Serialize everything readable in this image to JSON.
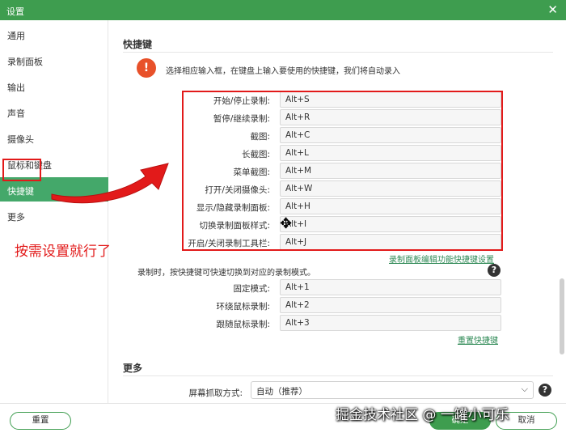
{
  "window": {
    "title": "设置",
    "close_glyph": "✕"
  },
  "sidebar": {
    "items": [
      {
        "label": "通用"
      },
      {
        "label": "录制面板"
      },
      {
        "label": "输出"
      },
      {
        "label": "声音"
      },
      {
        "label": "摄像头"
      },
      {
        "label": "鼠标和键盘"
      },
      {
        "label": "快捷键",
        "active": true
      },
      {
        "label": "更多"
      }
    ]
  },
  "annotation": {
    "text": "按需设置就行了",
    "color": "#e21a1a"
  },
  "shortcuts": {
    "title": "快捷键",
    "info_icon": "!",
    "info_text": "选择相应输入框，在键盘上输入要使用的快捷键，我们将自动录入",
    "rows": [
      {
        "label": "开始/停止录制:",
        "value": "Alt+S"
      },
      {
        "label": "暂停/继续录制:",
        "value": "Alt+R"
      },
      {
        "label": "截图:",
        "value": "Alt+C"
      },
      {
        "label": "长截图:",
        "value": "Alt+L"
      },
      {
        "label": "菜单截图:",
        "value": "Alt+M"
      },
      {
        "label": "打开/关闭摄像头:",
        "value": "Alt+W"
      },
      {
        "label": "显示/隐藏录制面板:",
        "value": "Alt+H"
      },
      {
        "label": "切换录制面板样式:",
        "value": "Alt+I"
      },
      {
        "label": "开启/关闭录制工具栏:",
        "value": "Alt+J"
      }
    ],
    "panel_link": "录制面板编辑功能快捷键设置",
    "mode_desc": "录制时，按快捷键可快速切换到对应的录制模式。",
    "help_icon": "?",
    "mode_rows": [
      {
        "label": "固定模式:",
        "value": "Alt+1"
      },
      {
        "label": "环绕鼠标录制:",
        "value": "Alt+2"
      },
      {
        "label": "跟随鼠标录制:",
        "value": "Alt+3"
      }
    ],
    "reset_link": "重置快捷键"
  },
  "more": {
    "title": "更多",
    "capture_label": "屏幕抓取方式:",
    "capture_value": "自动（推荐）",
    "chevron": "⌵"
  },
  "footer": {
    "reset_label": "重置",
    "ok_label": "确定",
    "cancel_label": "取消"
  },
  "watermark": "掘金技术社区 @ 一罐小可乐",
  "colors": {
    "accent": "#3e9d4f",
    "highlight": "#e21a1a",
    "warning": "#e8512a"
  }
}
